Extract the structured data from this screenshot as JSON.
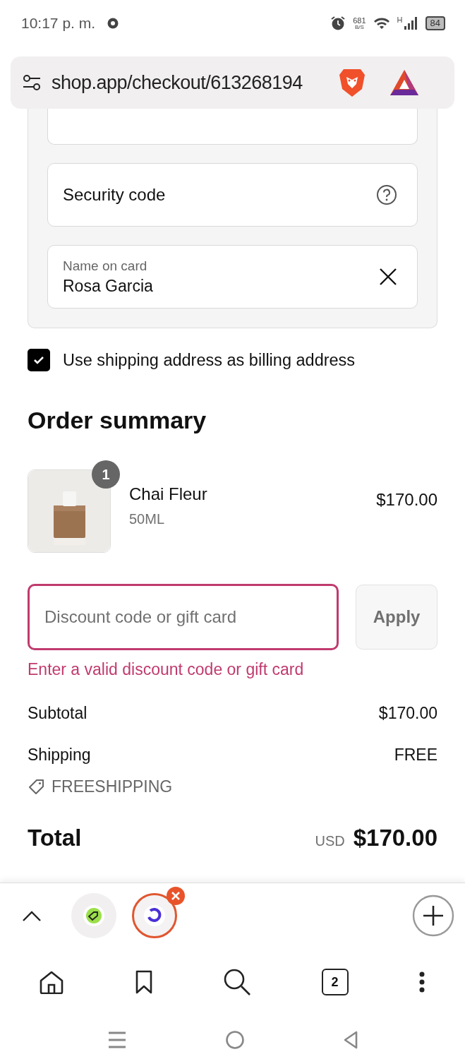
{
  "status_bar": {
    "time": "10:17 p. m.",
    "net_speed": "681",
    "net_unit": "B/S",
    "network": "H",
    "battery": "84"
  },
  "address_bar": {
    "url": "shop.app/checkout/613268194"
  },
  "payment_form": {
    "fields": [
      {
        "placeholder": "Security code",
        "kind": "help"
      },
      {
        "label": "Name on card",
        "value": "Rosa Garcia",
        "kind": "clear"
      }
    ]
  },
  "billing_checkbox": {
    "label": "Use shipping address as billing address",
    "checked": true
  },
  "order_summary": {
    "heading": "Order summary",
    "items": [
      {
        "name": "Chai Fleur",
        "variant": "50ML",
        "price": "$170.00",
        "quantity": "1"
      }
    ],
    "discount": {
      "placeholder": "Discount code or gift card",
      "focused": true,
      "button": "Apply",
      "error": "Enter a valid discount code or gift card"
    },
    "lines": [
      {
        "label": "Subtotal",
        "value": "$170.00"
      },
      {
        "label": "Shipping",
        "value": "FREE"
      }
    ],
    "applied_code": "FREESHIPPING",
    "total": {
      "label": "Total",
      "currency": "USD",
      "value": "$170.00"
    }
  },
  "browser_toolbar": {
    "tabs": [
      {
        "kind": "tag",
        "selected": false
      },
      {
        "kind": "swirl",
        "selected": true
      }
    ],
    "tab_count": "2"
  }
}
